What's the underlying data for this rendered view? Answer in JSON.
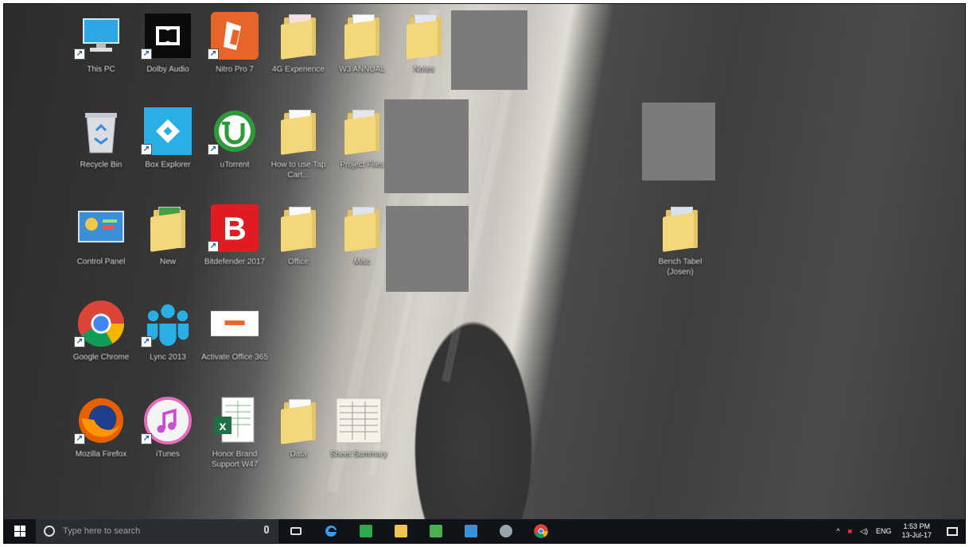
{
  "desktop": {
    "icons": [
      {
        "id": "this-pc",
        "label": "This PC",
        "type": "pc"
      },
      {
        "id": "dolby",
        "label": "Dolby Audio",
        "type": "dolby"
      },
      {
        "id": "nitro",
        "label": "Nitro Pro 7",
        "type": "nitro"
      },
      {
        "id": "folder-4g",
        "label": "4G Experience",
        "type": "folder"
      },
      {
        "id": "folder-w",
        "label": "W3 ANNUAL",
        "type": "folder"
      },
      {
        "id": "folder-3",
        "label": "Notes",
        "type": "folder"
      },
      {
        "id": "recycle-bin",
        "label": "Recycle Bin",
        "type": "bin"
      },
      {
        "id": "box",
        "label": "Box Explorer",
        "type": "box"
      },
      {
        "id": "utorrent",
        "label": "uTorrent",
        "type": "utorrent"
      },
      {
        "id": "folder-howto",
        "label": "How to use Tap Cart...",
        "type": "folder"
      },
      {
        "id": "folder-5",
        "label": "Project Files",
        "type": "folder"
      },
      {
        "id": "control-panel",
        "label": "Control Panel",
        "type": "cpanel"
      },
      {
        "id": "folder-new",
        "label": "New",
        "type": "folder-green"
      },
      {
        "id": "bitdefender",
        "label": "Bitdefender 2017",
        "type": "bitdefender"
      },
      {
        "id": "folder-office",
        "label": "Office",
        "type": "folder"
      },
      {
        "id": "folder-7",
        "label": "Misc",
        "type": "folder"
      },
      {
        "id": "folder-right",
        "label": "Bench Tabel (Josen)",
        "type": "folder"
      },
      {
        "id": "chrome",
        "label": "Google Chrome",
        "type": "chrome"
      },
      {
        "id": "lync",
        "label": "Lync 2013",
        "type": "lync"
      },
      {
        "id": "activate-office",
        "label": "Activate Office 365",
        "type": "office"
      },
      {
        "id": "firefox",
        "label": "Mozilla Firefox",
        "type": "firefox"
      },
      {
        "id": "itunes",
        "label": "iTunes",
        "type": "itunes"
      },
      {
        "id": "excel-file",
        "label": "Honor Brand Support W47",
        "type": "excel"
      },
      {
        "id": "folder-9",
        "label": "Data",
        "type": "folder"
      },
      {
        "id": "spreadsheet",
        "label": "Sheet Summary",
        "type": "sheet"
      }
    ]
  },
  "taskbar": {
    "search_placeholder": "Type here to search",
    "tray_lang": "ENG",
    "clock_time": "1:53 PM",
    "clock_date": "13-Jul-17"
  },
  "colors": {
    "taskbar": "#101418",
    "search_bg": "#2a2e33",
    "folder": "#f3d77a"
  }
}
